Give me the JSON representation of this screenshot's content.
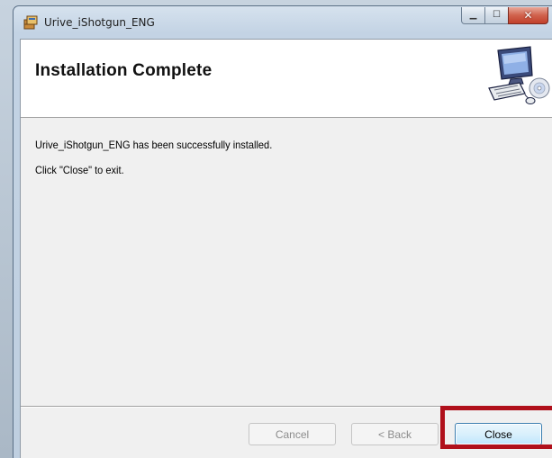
{
  "window": {
    "title": "Urive_iShotgun_ENG",
    "icons": {
      "app": "installer-package-icon",
      "minimize": "minimize-icon",
      "maximize": "maximize-icon",
      "close": "close-icon"
    },
    "caption": {
      "minimize_glyph": "▁",
      "maximize_glyph": "☐",
      "close_glyph": "✕"
    }
  },
  "banner": {
    "title": "Installation Complete",
    "graphic_icon": "computer-install-icon"
  },
  "body": {
    "message_line_1": "Urive_iShotgun_ENG has been successfully installed.",
    "message_line_2": "Click \"Close\" to exit."
  },
  "footer": {
    "cancel_label": "Cancel",
    "back_label": "< Back",
    "close_label": "Close"
  },
  "colors": {
    "highlight": "#b0101b",
    "close_caption_red": "#c2402b"
  }
}
